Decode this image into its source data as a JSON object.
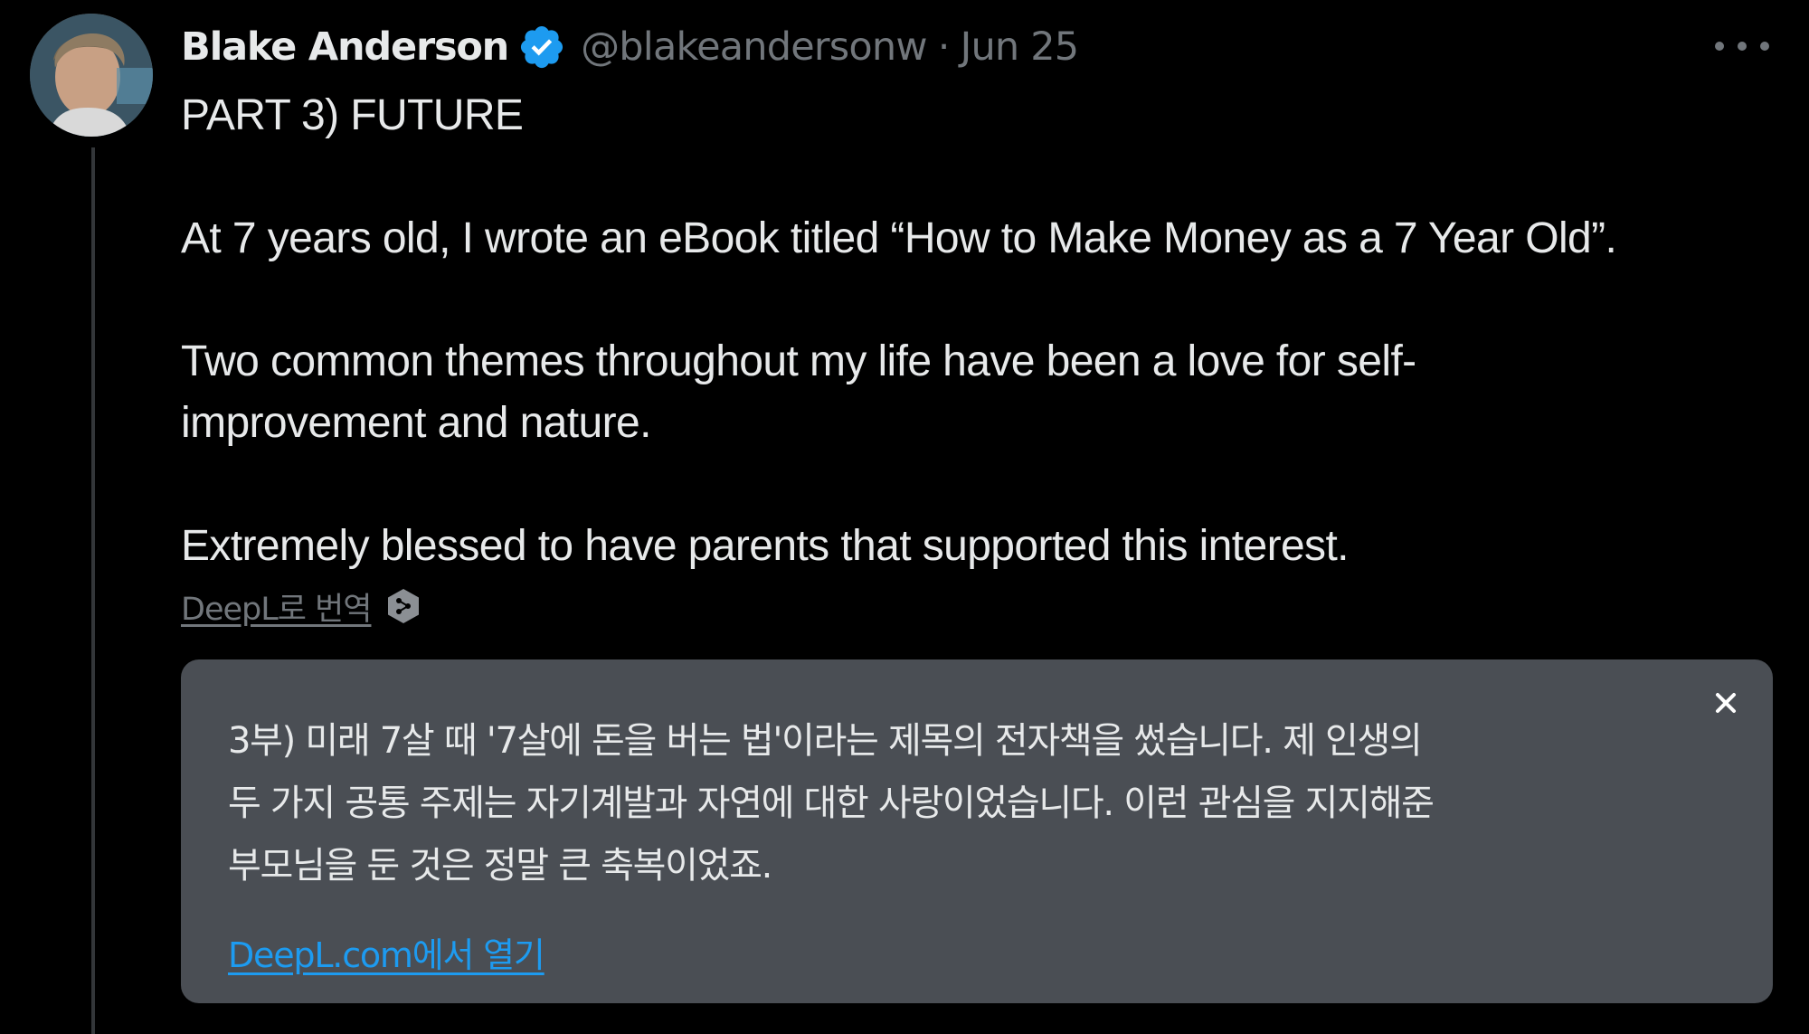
{
  "tweet": {
    "author": {
      "display_name": "Blake Anderson",
      "handle": "@blakeandersonw",
      "verified": true
    },
    "separator": "·",
    "date": "Jun 25",
    "text_lines": [
      "PART 3) FUTURE",
      "At 7 years old, I wrote an eBook titled “How to Make Money as a 7 Year Old”.",
      "Two common themes throughout my life have been a love for self-",
      "improvement and nature.",
      "Extremely blessed to have parents that supported this interest."
    ],
    "translate_link": "DeepL로 번역",
    "translation": {
      "lines": [
        "3부) 미래 7살 때 '7살에 돈을 버는 법'이라는 제목의 전자책을 썼습니다. 제 인생의",
        "두 가지 공통 주제는 자기계발과 자연에 대한 사랑이었습니다. 이런 관심을 지지해준",
        "부모님을 둔 것은 정말 큰 축복이었죠."
      ],
      "open_link": "DeepL.com에서 열기"
    }
  },
  "colors": {
    "background": "#000000",
    "text_primary": "#e7e9ea",
    "text_secondary": "#71767b",
    "verified_blue": "#1d9bf0",
    "link_blue": "#1d9bf0",
    "translation_bg": "#4a4e54"
  },
  "icons": {
    "verified": "verified-badge-icon",
    "more": "more-horizontal-icon",
    "deepl": "deepl-logo-icon",
    "close": "close-icon"
  }
}
